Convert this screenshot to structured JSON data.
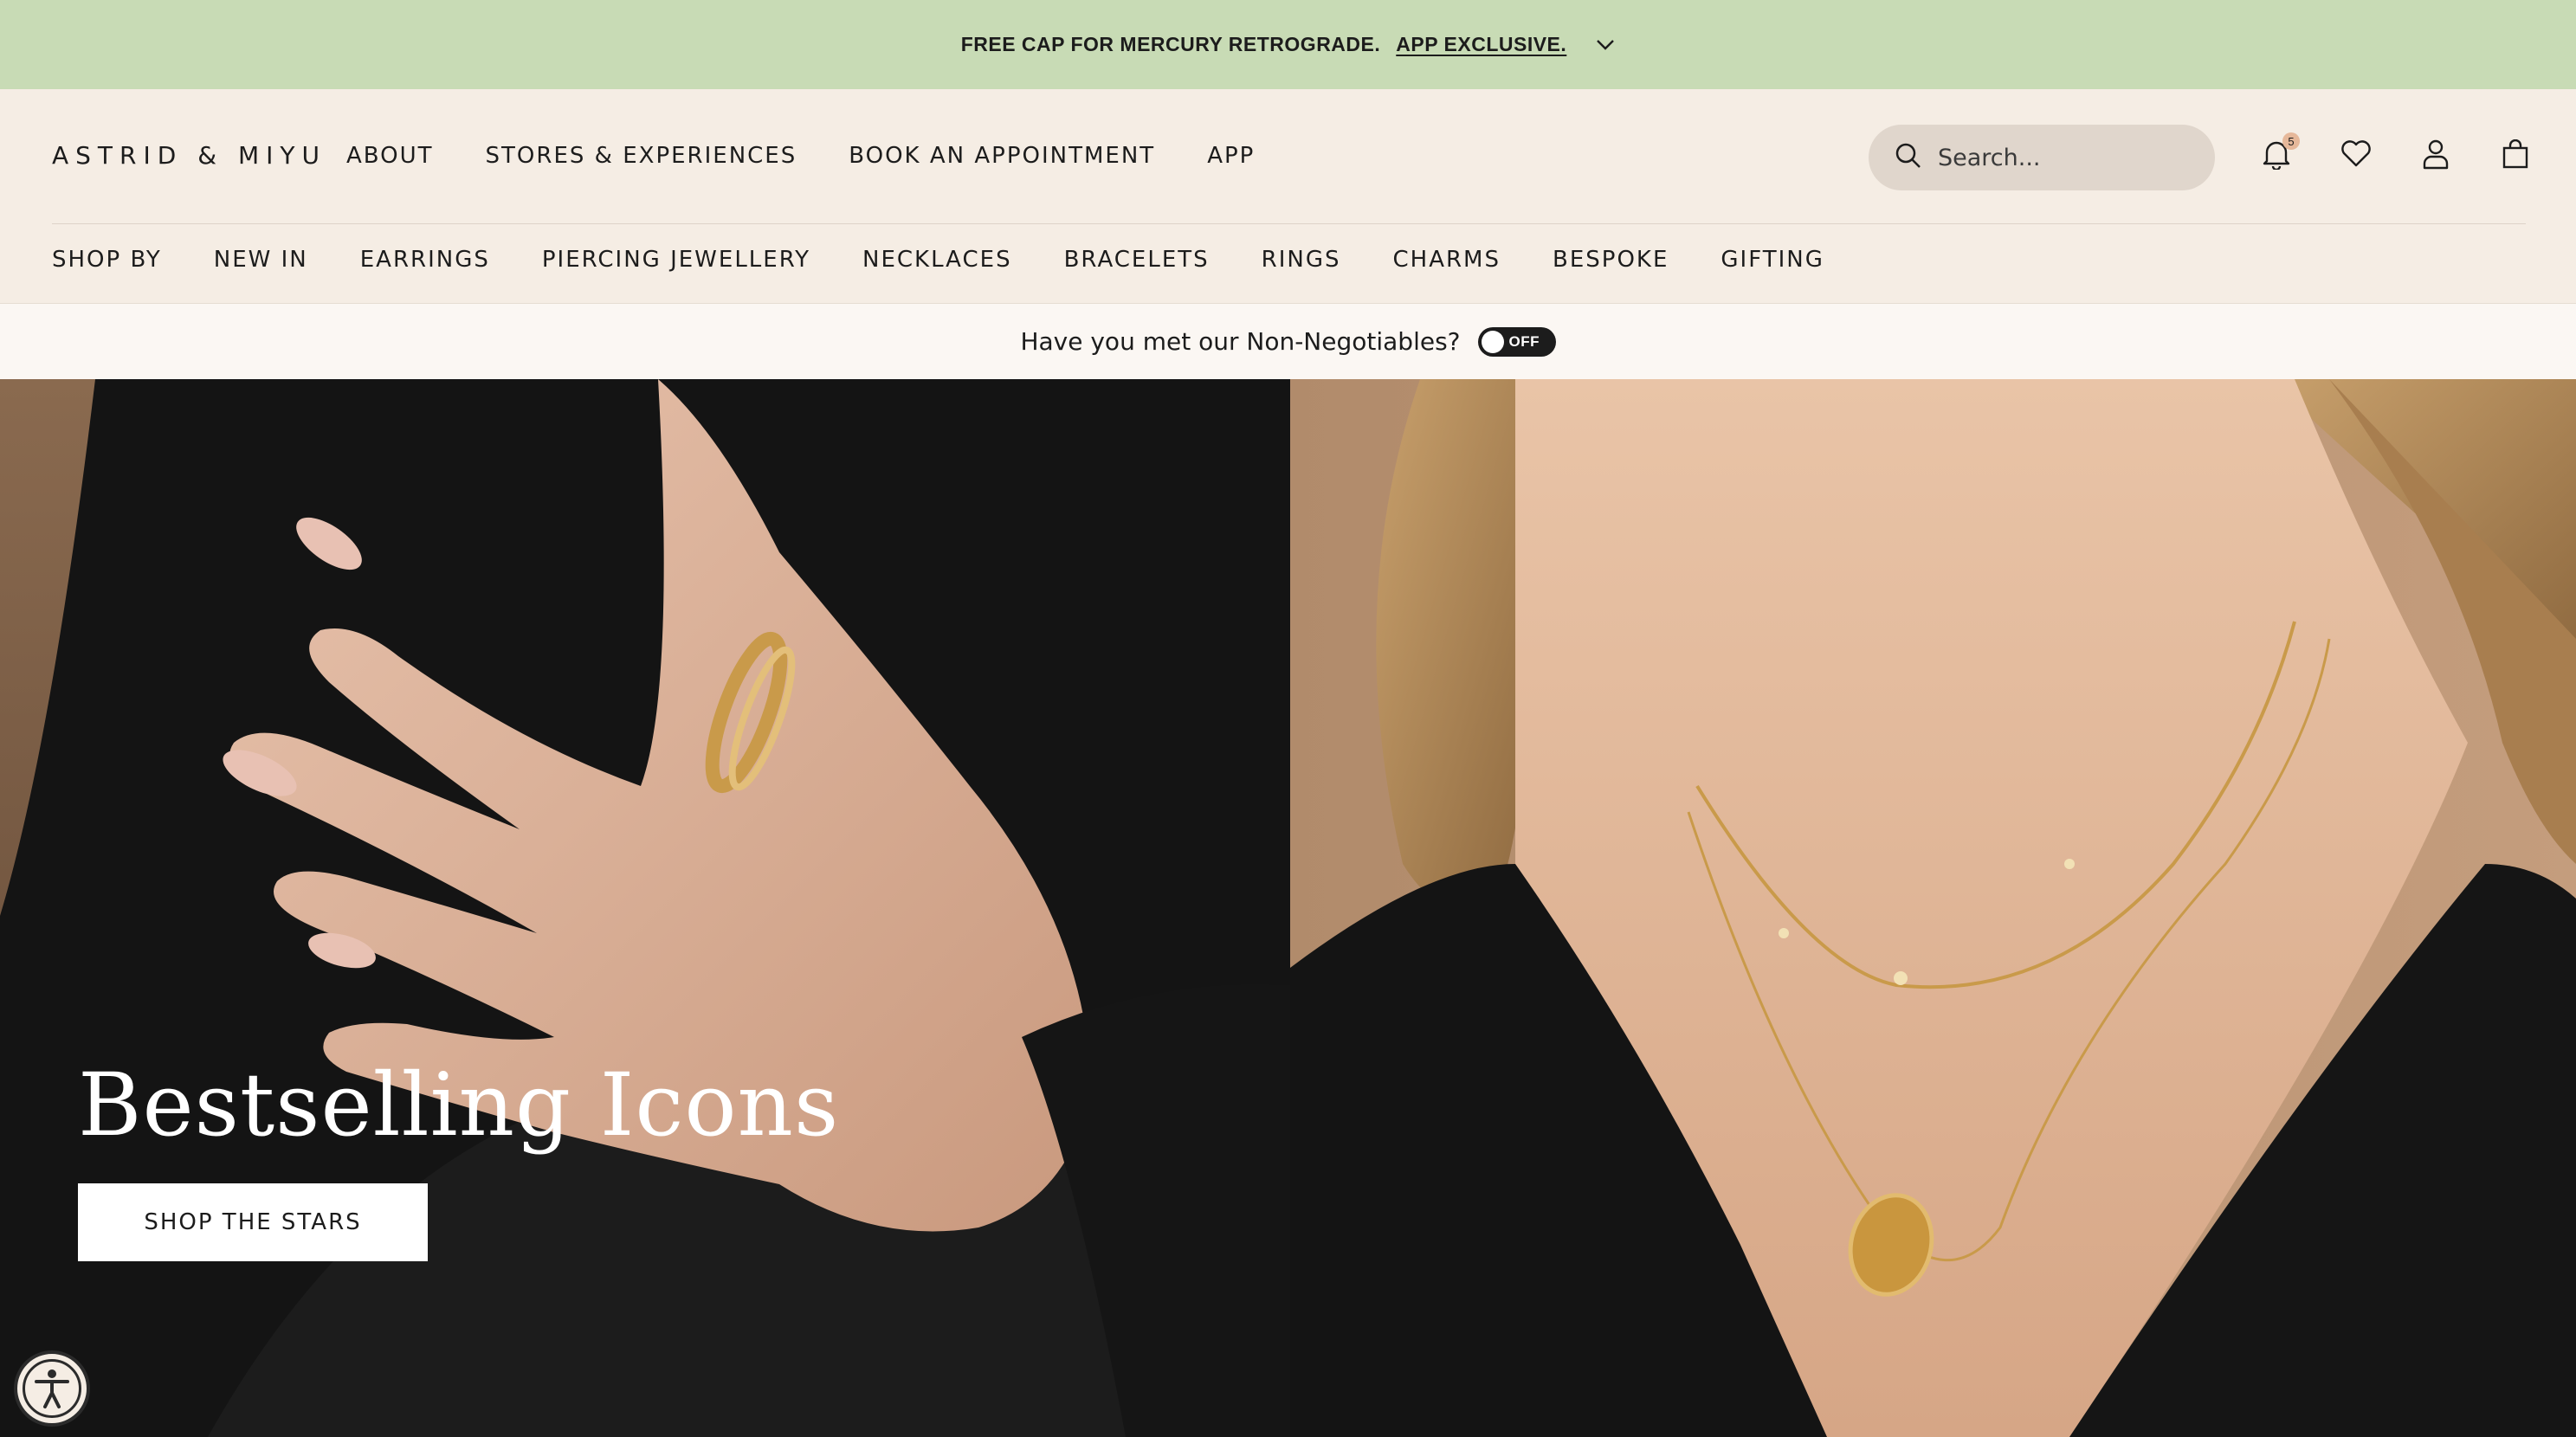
{
  "announcement": {
    "text": "FREE CAP FOR MERCURY RETROGRADE.",
    "link": "APP EXCLUSIVE.",
    "icon": "chevron-down-icon"
  },
  "header": {
    "logo": "ASTRID & MIYU",
    "top_nav": [
      "ABOUT",
      "STORES & EXPERIENCES",
      "BOOK AN APPOINTMENT",
      "APP"
    ],
    "search": {
      "placeholder": "Search..."
    },
    "icons": {
      "notifications": "bell-icon",
      "notifications_count": "5",
      "wishlist": "heart-icon",
      "account": "user-icon",
      "bag": "shopping-bag-icon"
    },
    "category_nav": [
      "SHOP BY",
      "NEW IN",
      "EARRINGS",
      "PIERCING JEWELLERY",
      "NECKLACES",
      "BRACELETS",
      "RINGS",
      "CHARMS",
      "BESPOKE",
      "GIFTING"
    ]
  },
  "notice": {
    "text": "Have you met our Non-Negotiables?",
    "toggle_label": "OFF"
  },
  "hero": {
    "title": "Bestselling Icons",
    "button": "SHOP THE STARS"
  },
  "accessibility": {
    "icon": "accessibility-icon"
  },
  "colors": {
    "announcement_bg": "#c8dbb5",
    "header_bg": "#f5ede4",
    "notice_bg": "#fbf7f3",
    "search_bg": "#e0d6cc",
    "text": "#1c1c1c"
  }
}
